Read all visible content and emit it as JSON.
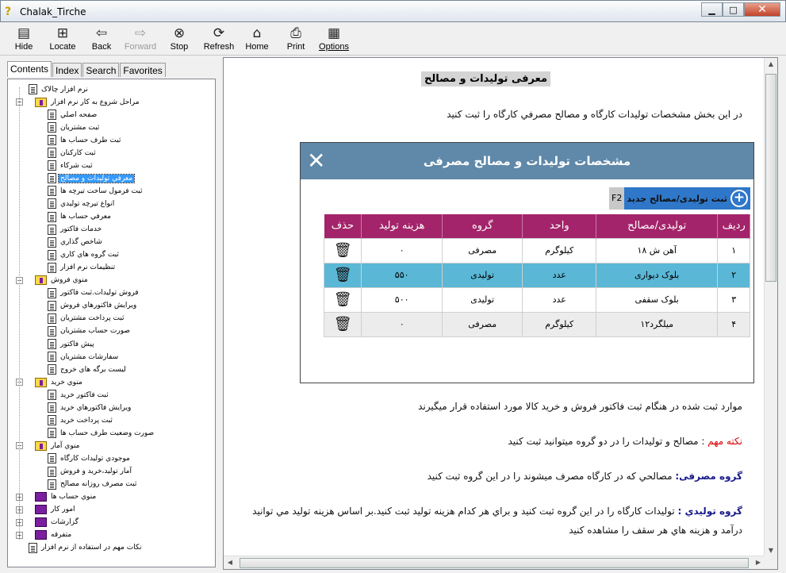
{
  "window": {
    "title": "Chalak_Tirche",
    "icon": "help-icon"
  },
  "toolbar": {
    "hide": "Hide",
    "locate": "Locate",
    "back": "Back",
    "forward": "Forward",
    "stop": "Stop",
    "refresh": "Refresh",
    "home": "Home",
    "print": "Print",
    "options": "Options"
  },
  "tabs": {
    "contents": "Contents",
    "index": "Index",
    "search": "Search",
    "favorites": "Favorites"
  },
  "tree": [
    {
      "label": "نرم افزار چالاک",
      "type": "page",
      "level": 1
    },
    {
      "label": "مراحل شروع به کار نرم افزار",
      "type": "book-open",
      "level": 0
    },
    {
      "label": "صفحه اصلي",
      "type": "page",
      "level": 2
    },
    {
      "label": "ثبت مشتريان",
      "type": "page",
      "level": 2
    },
    {
      "label": "ثبت طرف حساب ها",
      "type": "page",
      "level": 2
    },
    {
      "label": "ثبت کارکنان",
      "type": "page",
      "level": 2
    },
    {
      "label": "ثبت شرکاء",
      "type": "page",
      "level": 2
    },
    {
      "label": "معرفي توليدات و مصالح",
      "type": "page",
      "level": 2,
      "selected": true
    },
    {
      "label": "ثبت فرمول ساخت تيرچه ها",
      "type": "page",
      "level": 2
    },
    {
      "label": "انواع تيرچه توليدي",
      "type": "page",
      "level": 2
    },
    {
      "label": "معرفي حساب ها",
      "type": "page",
      "level": 2
    },
    {
      "label": "خدمات فاکتور",
      "type": "page",
      "level": 2
    },
    {
      "label": "شاخص گذاري",
      "type": "page",
      "level": 2
    },
    {
      "label": "ثبت گروه هاي کاري",
      "type": "page",
      "level": 2
    },
    {
      "label": "تنظيمات نرم افزار",
      "type": "page",
      "level": 2
    },
    {
      "label": "منوي فروش",
      "type": "book-open",
      "level": 0
    },
    {
      "label": "فروش توليدات.ثبت فاکتور",
      "type": "page",
      "level": 2
    },
    {
      "label": "ويرايش فاکتورهاي فروش",
      "type": "page",
      "level": 2
    },
    {
      "label": "ثبت پرداخت مشتريان",
      "type": "page",
      "level": 2
    },
    {
      "label": "صورت حساب مشتريان",
      "type": "page",
      "level": 2
    },
    {
      "label": "پيش فاکتور",
      "type": "page",
      "level": 2
    },
    {
      "label": "سفارشات مشتريان",
      "type": "page",
      "level": 2
    },
    {
      "label": "ليست برگه هاي خروج",
      "type": "page",
      "level": 2
    },
    {
      "label": "منوي خريد",
      "type": "book-open",
      "level": 0
    },
    {
      "label": "ثبت فاکتور خريد",
      "type": "page",
      "level": 2
    },
    {
      "label": "ويرايش فاکتورهاي خريد",
      "type": "page",
      "level": 2
    },
    {
      "label": "ثبت پرداخت خريد",
      "type": "page",
      "level": 2
    },
    {
      "label": "صورت وضعيت طرف حساب ها",
      "type": "page",
      "level": 2
    },
    {
      "label": "منوي آمار",
      "type": "book-open",
      "level": 0
    },
    {
      "label": "موجودي توليدات کارگاه",
      "type": "page",
      "level": 2
    },
    {
      "label": "آمار توليد،خريد و فروش",
      "type": "page",
      "level": 2
    },
    {
      "label": "ثبت مصرف روزانه مصالح",
      "type": "page",
      "level": 2
    },
    {
      "label": "منوي حساب ها",
      "type": "book-closed",
      "level": 0
    },
    {
      "label": "امور کار",
      "type": "book-closed",
      "level": 0
    },
    {
      "label": "گزارشات",
      "type": "book-closed",
      "level": 0
    },
    {
      "label": "متفرقه",
      "type": "book-closed",
      "level": 0
    },
    {
      "label": "نکات مهم در استفاده از نرم افزار",
      "type": "page-star",
      "level": 1
    }
  ],
  "doc": {
    "title": "معرفی تولیدات و مصالح",
    "intro": "در این بخش مشخصات تولیدات کارگاه و مصالح مصرفي کارگاه را ثبت کنید",
    "screenshot": {
      "header": "مشخصات تولیدات و مصالح مصرفی",
      "close": "✕",
      "add_button": "ثبت تولیدی/مصالح جدید",
      "shortcut": "F2",
      "columns": [
        "ردیف",
        "تولیدی/مصالح",
        "واحد",
        "گروه",
        "هزینه تولید",
        "حذف"
      ],
      "rows": [
        [
          "۱",
          "آهن ش ۱۸",
          "کیلوگرم",
          "مصرفی",
          "۰"
        ],
        [
          "۲",
          "بلوک دیواری",
          "عدد",
          "تولیدی",
          "۵۵۰"
        ],
        [
          "۳",
          "بلوک سقفی",
          "عدد",
          "تولیدی",
          "۵۰۰"
        ],
        [
          "۴",
          "میلگرد۱۲",
          "کیلوگرم",
          "مصرفی",
          "۰"
        ]
      ]
    },
    "p1": "موارد ثبت شده در هنگام ثبت فاکتور فروش و خرید کالا مورد استفاده قرار میگیرند",
    "note_label": "نکته مهم",
    "note_text": " : مصالح و تولیدات را در دو گروه میتوانید ثبت کنید",
    "g1_label": "گروه مصرفی:",
    "g1_text": " مصالحي که در کارگاه مصرف میشوند را در این گروه ثبت کنید",
    "g2_label": "گروه  تولیدي :",
    "g2_text": " تولیدات کارگاه را در این گروه ثبت کنید و براي هر کدام هزینه تولید ثبت کنید.بر اساس هزینه تولید مي توانید",
    "g2_text2": "درآمد و هزینه هاي هر سقف را مشاهده کنید"
  }
}
